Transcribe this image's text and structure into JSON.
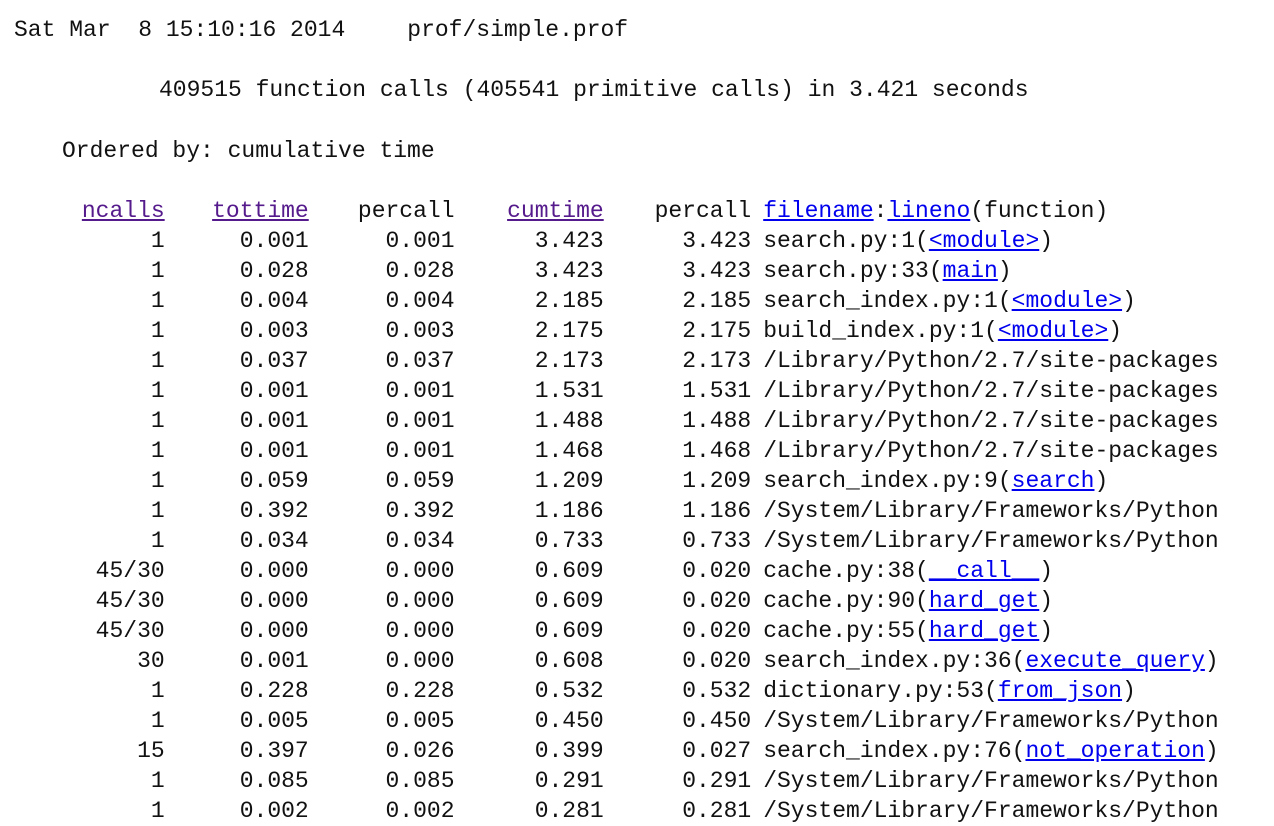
{
  "header": {
    "date": "Sat Mar  8 15:10:16 2014",
    "file": "prof/simple.prof",
    "summary": "409515 function calls (405541 primitive calls) in 3.421 seconds",
    "ordered_by": "Ordered by: cumulative time"
  },
  "colors": {
    "link": "#0000ee",
    "visited_link": "#551a8b",
    "text": "#111111"
  },
  "columns": {
    "ncalls": "ncalls",
    "tottime": "tottime",
    "percall1": "percall",
    "cumtime": "cumtime",
    "percall2": "percall",
    "filename": "filename",
    "colon": ":",
    "lineno": "lineno",
    "function": "(function)"
  },
  "rows": [
    {
      "ncalls": "1",
      "tottime": "0.001",
      "percall": "0.001",
      "cumtime": "3.423",
      "percall_cum": "3.423",
      "file": "search.py:1(",
      "func": "<module>",
      "close": ")"
    },
    {
      "ncalls": "1",
      "tottime": "0.028",
      "percall": "0.028",
      "cumtime": "3.423",
      "percall_cum": "3.423",
      "file": "search.py:33(",
      "func": "main",
      "close": ")"
    },
    {
      "ncalls": "1",
      "tottime": "0.004",
      "percall": "0.004",
      "cumtime": "2.185",
      "percall_cum": "2.185",
      "file": "search_index.py:1(",
      "func": "<module>",
      "close": ")"
    },
    {
      "ncalls": "1",
      "tottime": "0.003",
      "percall": "0.003",
      "cumtime": "2.175",
      "percall_cum": "2.175",
      "file": "build_index.py:1(",
      "func": "<module>",
      "close": ")"
    },
    {
      "ncalls": "1",
      "tottime": "0.037",
      "percall": "0.037",
      "cumtime": "2.173",
      "percall_cum": "2.173",
      "file": "/Library/Python/2.7/site-packages",
      "func": "",
      "close": ""
    },
    {
      "ncalls": "1",
      "tottime": "0.001",
      "percall": "0.001",
      "cumtime": "1.531",
      "percall_cum": "1.531",
      "file": "/Library/Python/2.7/site-packages",
      "func": "",
      "close": ""
    },
    {
      "ncalls": "1",
      "tottime": "0.001",
      "percall": "0.001",
      "cumtime": "1.488",
      "percall_cum": "1.488",
      "file": "/Library/Python/2.7/site-packages",
      "func": "",
      "close": ""
    },
    {
      "ncalls": "1",
      "tottime": "0.001",
      "percall": "0.001",
      "cumtime": "1.468",
      "percall_cum": "1.468",
      "file": "/Library/Python/2.7/site-packages",
      "func": "",
      "close": ""
    },
    {
      "ncalls": "1",
      "tottime": "0.059",
      "percall": "0.059",
      "cumtime": "1.209",
      "percall_cum": "1.209",
      "file": "search_index.py:9(",
      "func": "search",
      "close": ")"
    },
    {
      "ncalls": "1",
      "tottime": "0.392",
      "percall": "0.392",
      "cumtime": "1.186",
      "percall_cum": "1.186",
      "file": "/System/Library/Frameworks/Python",
      "func": "",
      "close": ""
    },
    {
      "ncalls": "1",
      "tottime": "0.034",
      "percall": "0.034",
      "cumtime": "0.733",
      "percall_cum": "0.733",
      "file": "/System/Library/Frameworks/Python",
      "func": "",
      "close": ""
    },
    {
      "ncalls": "45/30",
      "tottime": "0.000",
      "percall": "0.000",
      "cumtime": "0.609",
      "percall_cum": "0.020",
      "file": "cache.py:38(",
      "func": "__call__",
      "close": ")"
    },
    {
      "ncalls": "45/30",
      "tottime": "0.000",
      "percall": "0.000",
      "cumtime": "0.609",
      "percall_cum": "0.020",
      "file": "cache.py:90(",
      "func": "hard_get",
      "close": ")"
    },
    {
      "ncalls": "45/30",
      "tottime": "0.000",
      "percall": "0.000",
      "cumtime": "0.609",
      "percall_cum": "0.020",
      "file": "cache.py:55(",
      "func": "hard_get",
      "close": ")"
    },
    {
      "ncalls": "30",
      "tottime": "0.001",
      "percall": "0.000",
      "cumtime": "0.608",
      "percall_cum": "0.020",
      "file": "search_index.py:36(",
      "func": "execute_query",
      "close": ")"
    },
    {
      "ncalls": "1",
      "tottime": "0.228",
      "percall": "0.228",
      "cumtime": "0.532",
      "percall_cum": "0.532",
      "file": "dictionary.py:53(",
      "func": "from_json",
      "close": ")"
    },
    {
      "ncalls": "1",
      "tottime": "0.005",
      "percall": "0.005",
      "cumtime": "0.450",
      "percall_cum": "0.450",
      "file": "/System/Library/Frameworks/Python",
      "func": "",
      "close": ""
    },
    {
      "ncalls": "15",
      "tottime": "0.397",
      "percall": "0.026",
      "cumtime": "0.399",
      "percall_cum": "0.027",
      "file": "search_index.py:76(",
      "func": "not_operation",
      "close": ")"
    },
    {
      "ncalls": "1",
      "tottime": "0.085",
      "percall": "0.085",
      "cumtime": "0.291",
      "percall_cum": "0.291",
      "file": "/System/Library/Frameworks/Python",
      "func": "",
      "close": ""
    },
    {
      "ncalls": "1",
      "tottime": "0.002",
      "percall": "0.002",
      "cumtime": "0.281",
      "percall_cum": "0.281",
      "file": "/System/Library/Frameworks/Python",
      "func": "",
      "close": ""
    }
  ]
}
